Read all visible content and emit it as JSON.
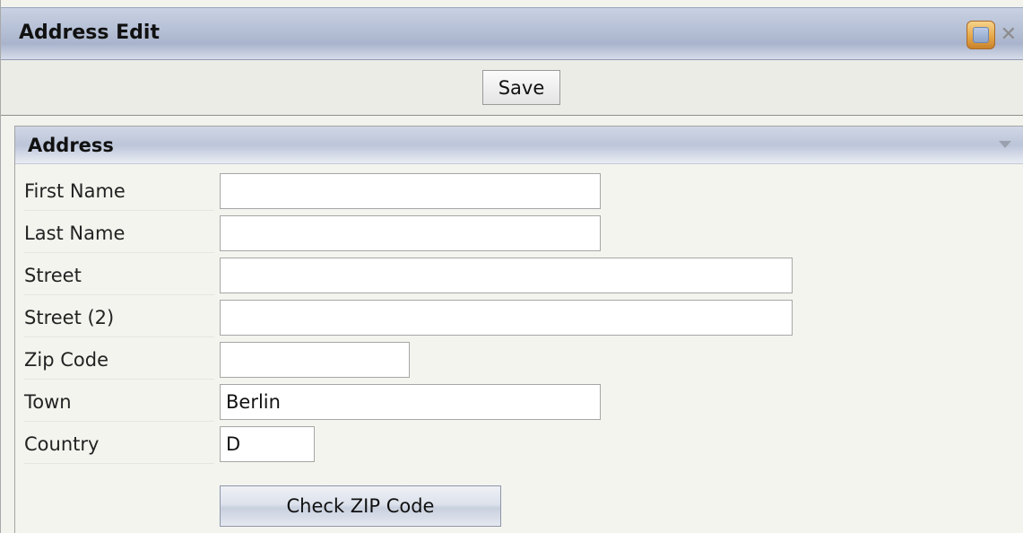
{
  "window": {
    "title": "Address Edit",
    "icons": [
      "wizard-icon",
      "close-icon"
    ],
    "close_glyph": "✕"
  },
  "toolbar": {
    "save_label": "Save"
  },
  "panel": {
    "title": "Address",
    "collapse_icon": "triangle-down-icon"
  },
  "form": {
    "first_name": {
      "label": "First Name",
      "value": ""
    },
    "last_name": {
      "label": "Last Name",
      "value": ""
    },
    "street": {
      "label": "Street",
      "value": ""
    },
    "street2": {
      "label": "Street (2)",
      "value": ""
    },
    "zip_code": {
      "label": "Zip Code",
      "value": ""
    },
    "town": {
      "label": "Town",
      "value": "Berlin"
    },
    "country": {
      "label": "Country",
      "value": "D"
    }
  },
  "actions": {
    "check_zip_label": "Check ZIP Code"
  },
  "colors": {
    "titlebar": "#b9c3d8",
    "background": "#f3f3ee",
    "input_border": "#a6a6a6"
  }
}
